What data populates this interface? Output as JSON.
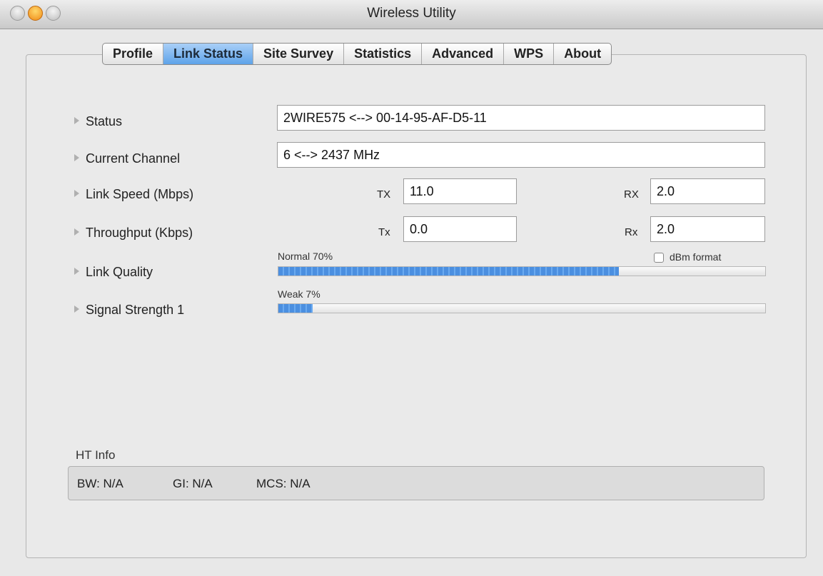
{
  "window": {
    "title": "Wireless Utility"
  },
  "tabs": [
    {
      "label": "Profile",
      "active": false
    },
    {
      "label": "Link Status",
      "active": true
    },
    {
      "label": "Site Survey",
      "active": false
    },
    {
      "label": "Statistics",
      "active": false
    },
    {
      "label": "Advanced",
      "active": false
    },
    {
      "label": "WPS",
      "active": false
    },
    {
      "label": "About",
      "active": false
    }
  ],
  "rows": {
    "status": {
      "label": "Status",
      "value": "2WIRE575 <--> 00-14-95-AF-D5-11"
    },
    "channel": {
      "label": "Current Channel",
      "value": "6 <--> 2437 MHz"
    },
    "link_speed": {
      "label": "Link Speed (Mbps)",
      "tx_label": "TX",
      "tx_value": "11.0",
      "rx_label": "RX",
      "rx_value": "2.0"
    },
    "throughput": {
      "label": "Throughput (Kbps)",
      "tx_label": "Tx",
      "tx_value": "0.0",
      "rx_label": "Rx",
      "rx_value": "2.0"
    },
    "link_quality": {
      "label": "Link Quality",
      "caption": "Normal 70%",
      "percent": 70
    },
    "signal_strength": {
      "label": "Signal Strength 1",
      "caption": "Weak 7%",
      "percent": 7
    }
  },
  "dbm_format": {
    "label": "dBm format",
    "checked": false
  },
  "ht_info": {
    "title": "HT Info",
    "bw": "BW: N/A",
    "gi": "GI: N/A",
    "mcs": "MCS: N/A"
  },
  "colors": {
    "accent": "#5ea3e9",
    "progress": "#4b8fe0"
  }
}
